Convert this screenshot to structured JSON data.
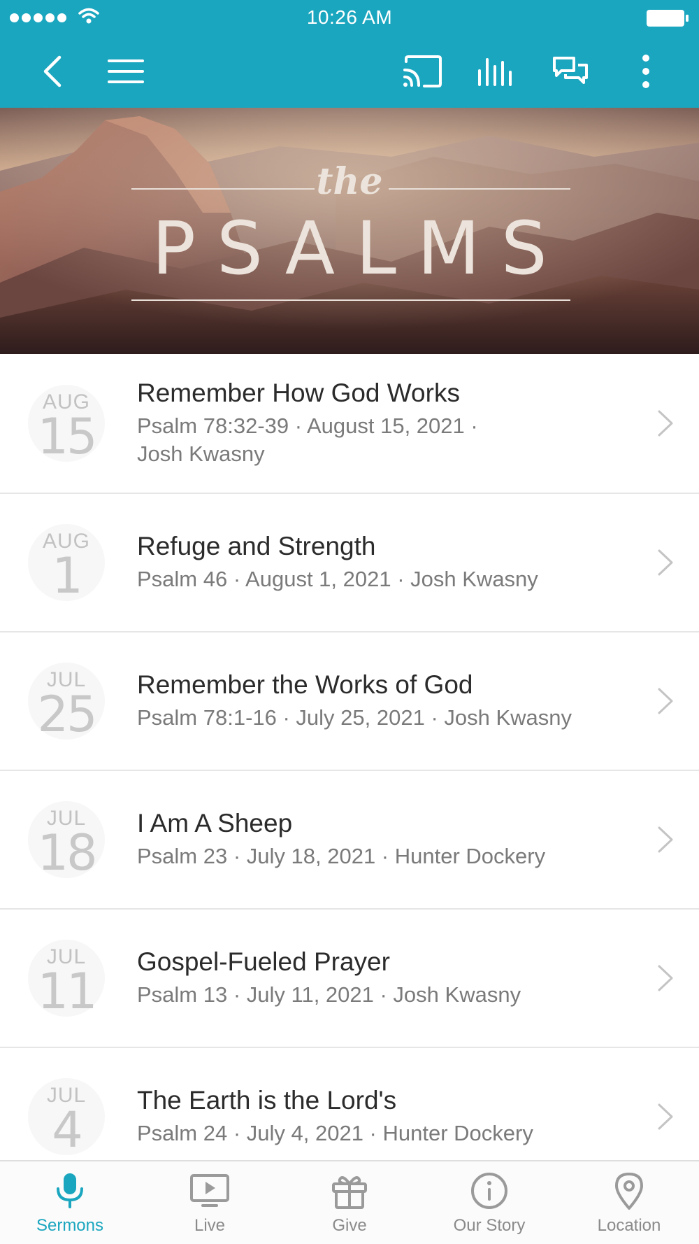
{
  "status_bar": {
    "time": "10:26 AM"
  },
  "hero": {
    "title_small": "the",
    "title_big": "PSALMS"
  },
  "sermons": [
    {
      "month": "AUG",
      "day": "15",
      "title": "Remember How God Works",
      "subtitle": "Psalm 78:32-39 · August 15, 2021 · Josh Kwasny"
    },
    {
      "month": "AUG",
      "day": "1",
      "title": "Refuge and Strength",
      "subtitle": "Psalm 46 · August 1, 2021 · Josh Kwasny"
    },
    {
      "month": "JUL",
      "day": "25",
      "title": "Remember the Works of God",
      "subtitle": "Psalm 78:1-16 · July 25, 2021 · Josh Kwasny"
    },
    {
      "month": "JUL",
      "day": "18",
      "title": "I Am A Sheep",
      "subtitle": "Psalm 23 · July 18, 2021 · Hunter Dockery"
    },
    {
      "month": "JUL",
      "day": "11",
      "title": "Gospel-Fueled Prayer",
      "subtitle": "Psalm 13 · July 11, 2021 · Josh Kwasny"
    },
    {
      "month": "JUL",
      "day": "4",
      "title": "The Earth is the Lord's",
      "subtitle": "Psalm 24 · July 4, 2021 · Hunter Dockery"
    }
  ],
  "tabs": [
    {
      "label": "Sermons",
      "icon": "microphone-icon",
      "active": true
    },
    {
      "label": "Live",
      "icon": "tv-play-icon",
      "active": false
    },
    {
      "label": "Give",
      "icon": "gift-icon",
      "active": false
    },
    {
      "label": "Our Story",
      "icon": "info-icon",
      "active": false
    },
    {
      "label": "Location",
      "icon": "map-pin-icon",
      "active": false
    }
  ],
  "colors": {
    "accent": "#1aa6bf",
    "text_primary": "#2b2b2b",
    "text_secondary": "#7a7a7a"
  }
}
